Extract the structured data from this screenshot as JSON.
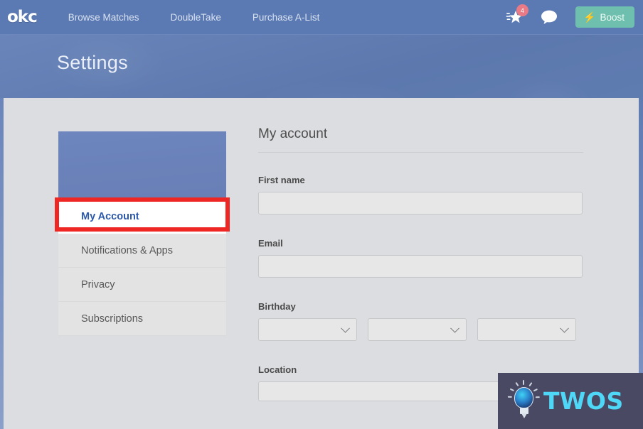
{
  "navbar": {
    "logo": "okc",
    "links": [
      {
        "label": "Browse Matches"
      },
      {
        "label": "DoubleTake"
      },
      {
        "label": "Purchase A-List"
      }
    ],
    "star_badge_count": "4",
    "boost_label": "Boost",
    "colors": {
      "bar_bg": "#5b7ab3",
      "boost_bg": "#6fbfae",
      "badge_bg": "#e97a86"
    }
  },
  "banner": {
    "title": "Settings",
    "bg_color": "#5f7cb1"
  },
  "sidebar": {
    "items": [
      {
        "label": "My Account",
        "active": true
      },
      {
        "label": "Notifications & Apps",
        "active": false
      },
      {
        "label": "Privacy",
        "active": false
      },
      {
        "label": "Subscriptions",
        "active": false
      }
    ],
    "active_text_color": "#2c59ab"
  },
  "annotation": {
    "color": "#ee2724",
    "target": "My Account"
  },
  "main": {
    "title": "My account",
    "fields": {
      "first_name": {
        "label": "First name",
        "value": "",
        "placeholder": ""
      },
      "email": {
        "label": "Email",
        "value": "",
        "placeholder": ""
      },
      "birthday": {
        "label": "Birthday",
        "month": {
          "value": "",
          "icon": "chevron-down-icon"
        },
        "day": {
          "value": "",
          "icon": "chevron-down-icon"
        },
        "year": {
          "value": "",
          "icon": "chevron-down-icon"
        }
      },
      "location": {
        "label": "Location",
        "value": "",
        "placeholder": ""
      }
    }
  },
  "watermark": {
    "text": "TWOS",
    "bg_color": "#4a4963",
    "text_color": "#4fd7f7",
    "icon": "lightbulb-icon"
  }
}
